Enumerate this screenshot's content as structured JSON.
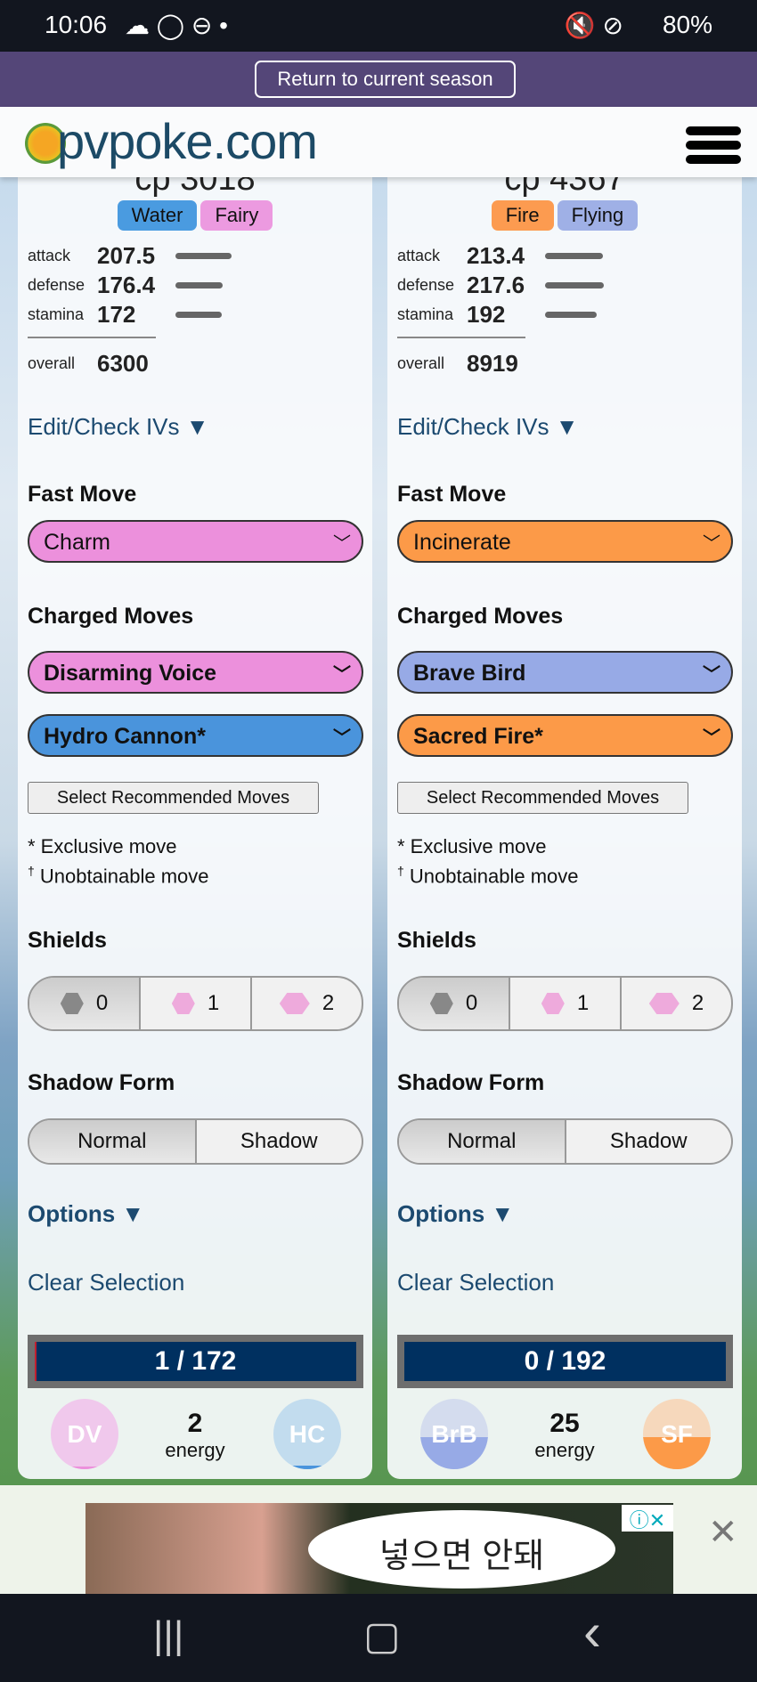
{
  "status_bar": {
    "time": "10:06",
    "icons": [
      "cloud-icon",
      "circle-icon",
      "minus-circle-icon",
      "dot-icon"
    ],
    "right_icons": [
      "mute-icon",
      "wifi-icon",
      "blocked-icon"
    ],
    "battery": "80%"
  },
  "season_banner": {
    "button": "Return to current season"
  },
  "header": {
    "logo": "pvpoke.com",
    "menu_icon": "hamburger-icon"
  },
  "cards": [
    {
      "cp": "cp 3018",
      "types": [
        {
          "name": "Water",
          "color": "#4a9be0"
        },
        {
          "name": "Fairy",
          "color": "#ec9ae0"
        }
      ],
      "stats": {
        "attack_label": "attack",
        "attack": "207.5",
        "defense_label": "defense",
        "defense": "176.4",
        "stamina_label": "stamina",
        "stamina": "172",
        "overall_label": "overall",
        "overall": "6300"
      },
      "edit_ivs": "Edit/Check IVs ▼",
      "fast_label": "Fast Move",
      "fast": {
        "name": "Charm",
        "color": "#ec90dc"
      },
      "charged_label": "Charged Moves",
      "charged": [
        {
          "name": "Disarming Voice",
          "color": "#ec90dc"
        },
        {
          "name": "Hydro Cannon*",
          "color": "#4a94dc"
        }
      ],
      "recommend": "Select Recommended Moves",
      "exclusive": "* Exclusive move",
      "unobtainable_mark": "†",
      "unobtainable": "Unobtainable move",
      "shields_label": "Shields",
      "shields": [
        "0",
        "1",
        "2"
      ],
      "shields_selected": 0,
      "shadow_label": "Shadow Form",
      "shadow": [
        "Normal",
        "Shadow"
      ],
      "shadow_selected": 0,
      "options": "Options ▼",
      "clear": "Clear Selection",
      "hp": "1 / 172",
      "hp_fraction": 0.006,
      "move_a": {
        "abbr": "DV",
        "color": "#f0c8ec",
        "fill_color": "#ec90dc",
        "fill": 0.04
      },
      "energy": "2",
      "energy_label": "energy",
      "move_b": {
        "abbr": "HC",
        "color": "#c2dcee",
        "fill_color": "#4a94dc",
        "fill": 0.05
      }
    },
    {
      "cp": "cp 4367",
      "types": [
        {
          "name": "Fire",
          "color": "#fc9b50"
        },
        {
          "name": "Flying",
          "color": "#9fb0e6"
        }
      ],
      "stats": {
        "attack_label": "attack",
        "attack": "213.4",
        "defense_label": "defense",
        "defense": "217.6",
        "stamina_label": "stamina",
        "stamina": "192",
        "overall_label": "overall",
        "overall": "8919"
      },
      "edit_ivs": "Edit/Check IVs ▼",
      "fast_label": "Fast Move",
      "fast": {
        "name": "Incinerate",
        "color": "#fc9a48"
      },
      "charged_label": "Charged Moves",
      "charged": [
        {
          "name": "Brave Bird",
          "color": "#97aae6"
        },
        {
          "name": "Sacred Fire*",
          "color": "#fc9a48"
        }
      ],
      "recommend": "Select Recommended Moves",
      "exclusive": "* Exclusive move",
      "unobtainable_mark": "†",
      "unobtainable": "Unobtainable move",
      "shields_label": "Shields",
      "shields": [
        "0",
        "1",
        "2"
      ],
      "shields_selected": 0,
      "shadow_label": "Shadow Form",
      "shadow": [
        "Normal",
        "Shadow"
      ],
      "shadow_selected": 0,
      "options": "Options ▼",
      "clear": "Clear Selection",
      "hp": "0 / 192",
      "hp_fraction": 0,
      "move_a": {
        "abbr": "BrB",
        "color": "#d4dcee",
        "fill_color": "#97aae6",
        "fill": 0.45
      },
      "energy": "25",
      "energy_label": "energy",
      "move_b": {
        "abbr": "SF",
        "color": "#f6d8bc",
        "fill_color": "#fc9a48",
        "fill": 0.45
      }
    }
  ],
  "ad": {
    "text": "넣으면 안돼",
    "close": "✕",
    "info_icon": "info-icon"
  },
  "nav": {
    "recent": "|||",
    "home": "▢",
    "back": "‹"
  }
}
